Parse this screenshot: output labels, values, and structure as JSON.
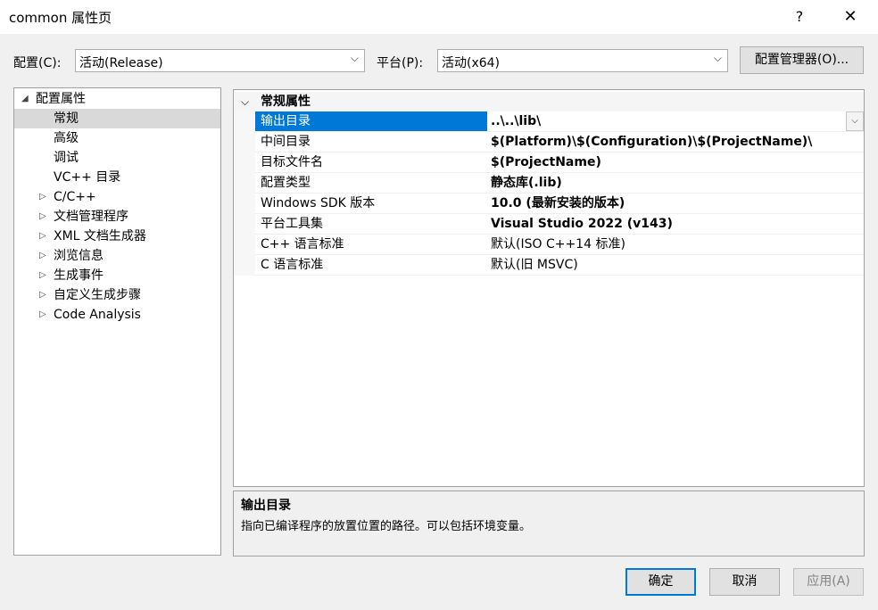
{
  "window": {
    "title": "common 属性页",
    "help": "?",
    "close": "✕"
  },
  "config": {
    "config_label": "配置(C):",
    "config_value": "活动(Release)",
    "platform_label": "平台(P):",
    "platform_value": "活动(x64)",
    "manager_button": "配置管理器(O)..."
  },
  "tree": {
    "root": "配置属性",
    "items": [
      {
        "label": "常规",
        "expandable": false,
        "selected": true
      },
      {
        "label": "高级",
        "expandable": false
      },
      {
        "label": "调试",
        "expandable": false
      },
      {
        "label": "VC++ 目录",
        "expandable": false
      },
      {
        "label": "C/C++",
        "expandable": true
      },
      {
        "label": "文档管理程序",
        "expandable": true
      },
      {
        "label": "XML 文档生成器",
        "expandable": true
      },
      {
        "label": "浏览信息",
        "expandable": true
      },
      {
        "label": "生成事件",
        "expandable": true
      },
      {
        "label": "自定义生成步骤",
        "expandable": true
      },
      {
        "label": "Code Analysis",
        "expandable": true
      }
    ]
  },
  "grid": {
    "section": "常规属性",
    "rows": [
      {
        "name": "输出目录",
        "value": "..\\..\\lib\\"
      },
      {
        "name": "中间目录",
        "value": "$(Platform)\\$(Configuration)\\$(ProjectName)\\"
      },
      {
        "name": "目标文件名",
        "value": "$(ProjectName)"
      },
      {
        "name": "配置类型",
        "value": "静态库(.lib)"
      },
      {
        "name": "Windows SDK 版本",
        "value": "10.0 (最新安装的版本)"
      },
      {
        "name": "平台工具集",
        "value": "Visual Studio 2022 (v143)"
      },
      {
        "name": "C++ 语言标准",
        "value": "默认(ISO C++14 标准)"
      },
      {
        "name": "C 语言标准",
        "value": "默认(旧 MSVC)"
      }
    ]
  },
  "description": {
    "title": "输出目录",
    "text": "指向已编译程序的放置位置的路径。可以包括环境变量。"
  },
  "buttons": {
    "ok": "确定",
    "cancel": "取消",
    "apply": "应用(A)"
  },
  "icons": {
    "expand": "triangle-right-icon",
    "collapse": "triangle-down-icon",
    "dropdown": "chevron-down-icon"
  },
  "colors": {
    "selection": "#0078d7",
    "tree_selection": "#d9d9d9",
    "ok_border": "#0078d7"
  }
}
